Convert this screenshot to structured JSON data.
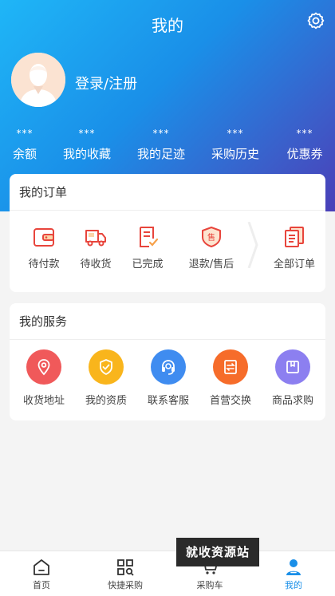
{
  "header": {
    "title": "我的",
    "login_text": "登录/注册"
  },
  "stats": [
    {
      "value": "***",
      "label": "余额"
    },
    {
      "value": "***",
      "label": "我的收藏"
    },
    {
      "value": "***",
      "label": "我的足迹"
    },
    {
      "value": "***",
      "label": "采购历史"
    },
    {
      "value": "***",
      "label": "优惠券"
    }
  ],
  "orders": {
    "title": "我的订单",
    "items": [
      {
        "label": "待付款",
        "icon": "wallet-icon"
      },
      {
        "label": "待收货",
        "icon": "truck-icon"
      },
      {
        "label": "已完成",
        "icon": "completed-doc-icon"
      },
      {
        "label": "退款/售后",
        "icon": "after-sale-shield-icon"
      },
      {
        "label": "全部订单",
        "icon": "order-list-icon"
      }
    ],
    "color": "#e8453c"
  },
  "services": {
    "title": "我的服务",
    "items": [
      {
        "label": "收货地址",
        "icon": "location-pin-icon",
        "color": "#f0595a"
      },
      {
        "label": "我的资质",
        "icon": "shield-check-icon",
        "color": "#f9b51c"
      },
      {
        "label": "联系客服",
        "icon": "headset-icon",
        "color": "#3f8cf0"
      },
      {
        "label": "首营交换",
        "icon": "exchange-doc-icon",
        "color": "#f66c2a"
      },
      {
        "label": "商品求购",
        "icon": "box-icon",
        "color": "#8c7ff0"
      }
    ]
  },
  "tabbar": {
    "items": [
      {
        "label": "首页",
        "icon": "home-icon"
      },
      {
        "label": "快捷采购",
        "icon": "grid-search-icon"
      },
      {
        "label": "采购车",
        "icon": "cart-icon"
      },
      {
        "label": "我的",
        "icon": "user-icon",
        "active": true
      }
    ],
    "active_color": "#1a8fe8"
  },
  "watermark": "就收资源站"
}
